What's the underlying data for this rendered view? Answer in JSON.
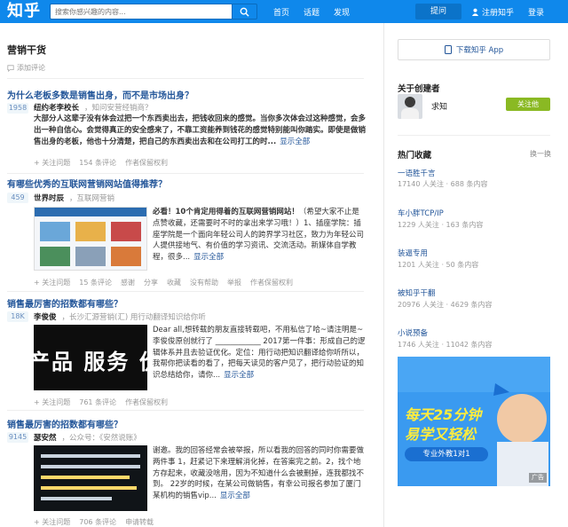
{
  "header": {
    "logo": "知乎",
    "search_placeholder": "搜索你感兴趣的内容...",
    "nav": [
      "首页",
      "话题",
      "发现"
    ],
    "ask": "提问",
    "register": "注册知乎",
    "login": "登录"
  },
  "page": {
    "title": "营销干货",
    "add_comment": "添加评论"
  },
  "items": [
    {
      "question": "为什么老板多数是销售出身，而不是市场出身？",
      "votes": "1958",
      "author": "纽约老李校长",
      "author_sig": "，知问安营经销商？",
      "body": "大部分人这辈子没有体会过把一个东西卖出去，把钱收回来的感觉。当你多次体会过这种感觉，会多出一种自信心。会觉得真正的安全感来了，不靠工资能养到钱花的感觉特别能叫你踏实。即使是做销售出身的老板，他也十分清楚，把自己的东西卖出去和在公司打工的时...",
      "more": "显示全部",
      "meta": [
        "+ 关注问题",
        "154 条评论",
        "作者保留权利"
      ]
    },
    {
      "question": "有哪些优秀的互联网营销网站值得推荐？",
      "votes": "459",
      "author": "世界时辰",
      "author_sig": "，互联网营销",
      "body_bold": "必看！10个肯定用得着的互联网营销网站！",
      "body": "（希望大家不止是点赞收藏，还需要时不时的拿出来学习哦！）1、插座学院：插座学院是一个面向年轻公司人的跨界学习社区，致力为年轻公司人提供接地气、有价值的学习资讯、交流活动。新媒体自学教程，很多...",
      "more": "显示全部",
      "meta": [
        "+ 关注问题",
        "15 条评论",
        "感谢",
        "分享",
        "收藏",
        "没有帮助",
        "举报",
        "作者保留权利"
      ]
    },
    {
      "question": "销售最厉害的招数都有哪些？",
      "votes": "18K",
      "author": "李俊俊",
      "author_sig": "，长沙汇源营销(汇) 用行动翻译知识给你听",
      "body": "Dear all,想转载的朋友直接转载吧，不用私信了哈~请注明是~李俊俊原创就行了 ____________ 2017第一件事：形成自己的逻辑体系并且去验证优化。定位：用行动把知识翻译给你听所以，我帮你把读看的看了，把每天读见的客户见了，把行动验证的知识总结给你，请你...",
      "more": "显示全部",
      "thumb_text": "产品 服务 价值",
      "meta": [
        "+ 关注问题",
        "761 条评论",
        "作者保留权利"
      ]
    },
    {
      "question": "销售最厉害的招数都有哪些？",
      "votes": "9145",
      "author": "瑟安然",
      "author_sig": "，公众号：《安然说账》",
      "body": "谢邀。我的回答经常会被举报，所以看我的回答的同时你需要做两件事 1，赶紧记下来理解消化掉，在答案完之前。2，找个地方存起来，收藏没啥用，因为不知道什么会被删掉，连我都找不到。 22岁的时候，在某公司做销售，有幸公司报名参加了厦门某机构的销售vip...",
      "more": "显示全部",
      "meta": [
        "+ 关注问题",
        "706 条评论",
        "申请转载"
      ]
    }
  ],
  "sidebar": {
    "download": "下载知乎 App",
    "creator_title": "关于创建者",
    "creator_name": "求知",
    "follow": "关注他",
    "hot_title": "热门收藏",
    "refresh": "换一换",
    "collections": [
      {
        "name": "一语胜千言",
        "followers": "17140 人关注",
        "items": "688 条内容"
      },
      {
        "name": "车小胖TCP/IP",
        "followers": "1229 人关注",
        "items": "163 条内容"
      },
      {
        "name": "装逼专用",
        "followers": "1201 人关注",
        "items": "50 条内容"
      },
      {
        "name": "被知乎干翻",
        "followers": "20976 人关注",
        "items": "4629 条内容"
      },
      {
        "name": "小说预备",
        "followers": "1746 人关注",
        "items": "11042 条内容"
      }
    ],
    "ad": {
      "line1": "每天25分钟",
      "line2": "易学又轻松",
      "cta": "专业外教1对1",
      "tag": "广告"
    }
  }
}
